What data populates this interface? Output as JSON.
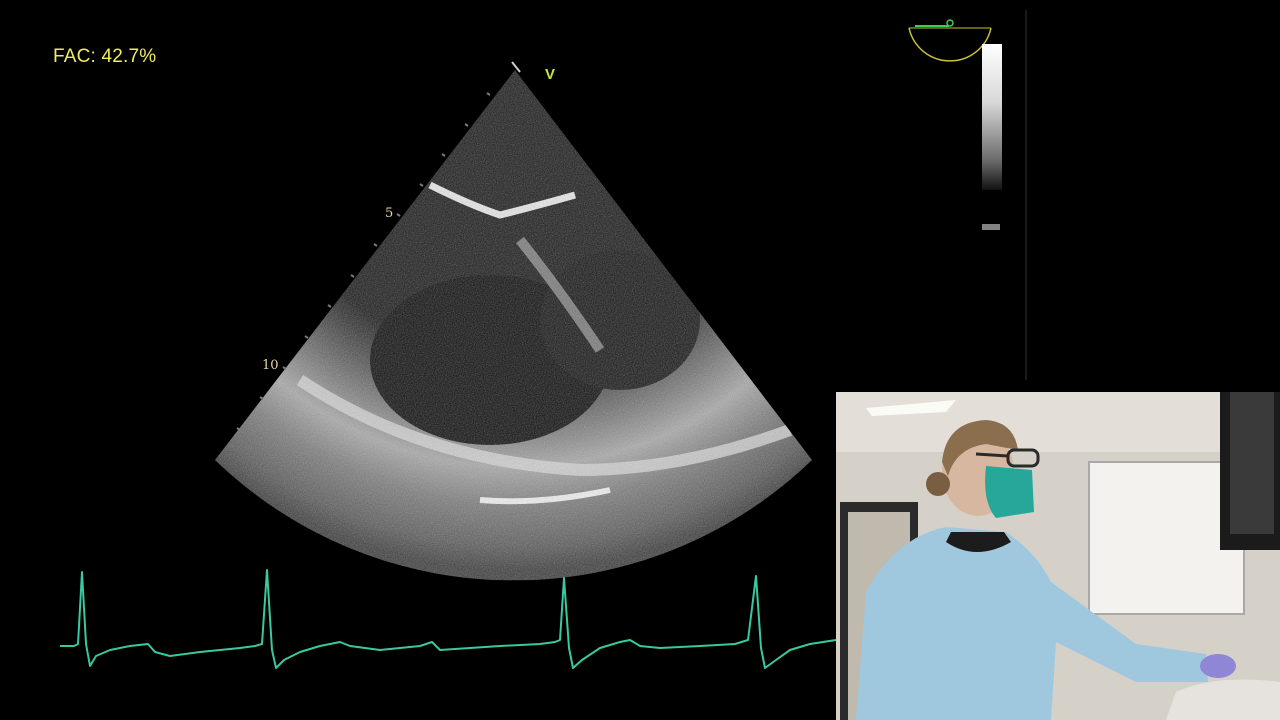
{
  "overlay": {
    "fac_label": "FAC: 42.7%",
    "probe_marker": "V",
    "depth_marks": [
      "5",
      "10"
    ],
    "angle_indicator_value": "0"
  },
  "ecg": {
    "trace_color": "#39c8a0",
    "rhythm": "sinus"
  },
  "ultrasound": {
    "mode": "2D",
    "view": "transgastric mid-papillary short-axis"
  },
  "video_inset": {
    "subject": "operator in blue gown, teal mask and glasses",
    "gown_color": "#9fc8df"
  },
  "colors": {
    "fac_text": "#f2ec5a",
    "background": "#000000"
  }
}
